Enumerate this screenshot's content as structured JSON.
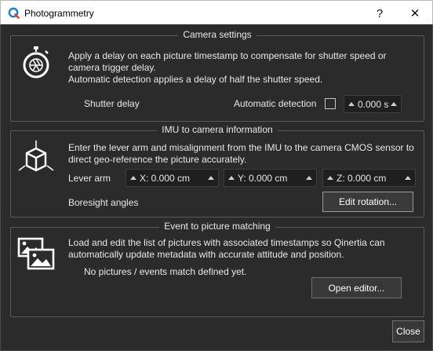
{
  "window": {
    "title": "Photogrammetry",
    "help_glyph": "?",
    "close_glyph": "✕"
  },
  "camera_settings": {
    "legend": "Camera settings",
    "description_1": "Apply a delay on each picture timestamp to compensate for shutter speed or",
    "description_2": "camera trigger delay.",
    "description_3": "Automatic detection applies a delay of half the shutter speed.",
    "shutter_delay_label": "Shutter delay",
    "automatic_detection_label": "Automatic detection",
    "automatic_detection_checked": false,
    "shutter_delay_value": "0.000 s"
  },
  "imu": {
    "legend": "IMU to camera information",
    "description_1": "Enter the lever arm and misalignment from the IMU to the camera CMOS sensor to",
    "description_2": "direct geo-reference the picture accurately.",
    "lever_arm_label": "Lever arm",
    "x_value": "X: 0.000 cm",
    "y_value": "Y: 0.000 cm",
    "z_value": "Z: 0.000 cm",
    "boresight_label": "Boresight angles",
    "edit_rotation_label": "Edit rotation..."
  },
  "events": {
    "legend": "Event to picture matching",
    "description_1": "Load and edit the list of pictures with associated timestamps so Qinertia can",
    "description_2": "automatically update metadata with accurate attitude and position.",
    "status_text": "No pictures / events match defined yet.",
    "open_editor_label": "Open editor..."
  },
  "footer": {
    "close_label": "Close"
  },
  "colors": {
    "background": "#2b2b2b",
    "brand": "#1f7fc4",
    "text": "#e8e8e8"
  }
}
